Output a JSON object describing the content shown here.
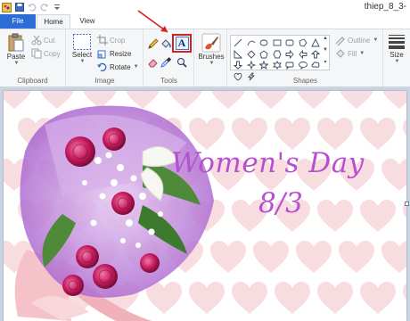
{
  "window": {
    "title": "thiep_8_3-"
  },
  "tabs": {
    "file": "File",
    "home": "Home",
    "view": "View"
  },
  "clipboard": {
    "paste": "Paste",
    "cut": "Cut",
    "copy": "Copy",
    "label": "Clipboard"
  },
  "image": {
    "select": "Select",
    "crop": "Crop",
    "resize": "Resize",
    "rotate": "Rotate",
    "label": "Image"
  },
  "tools": {
    "text_tool_glyph": "A",
    "label": "Tools"
  },
  "brushes": {
    "label": "Brushes"
  },
  "shapes": {
    "outline": "Outline",
    "fill": "Fill",
    "label": "Shapes"
  },
  "size": {
    "label": "Size"
  },
  "canvas": {
    "line1": "Women's Day",
    "line2": "8/3"
  },
  "colors": {
    "accent": "#2b6cd6",
    "highlight": "#d42020",
    "text": "#b74fd1",
    "heart": "#f7dde0",
    "workspace": "#c9d5e4"
  }
}
